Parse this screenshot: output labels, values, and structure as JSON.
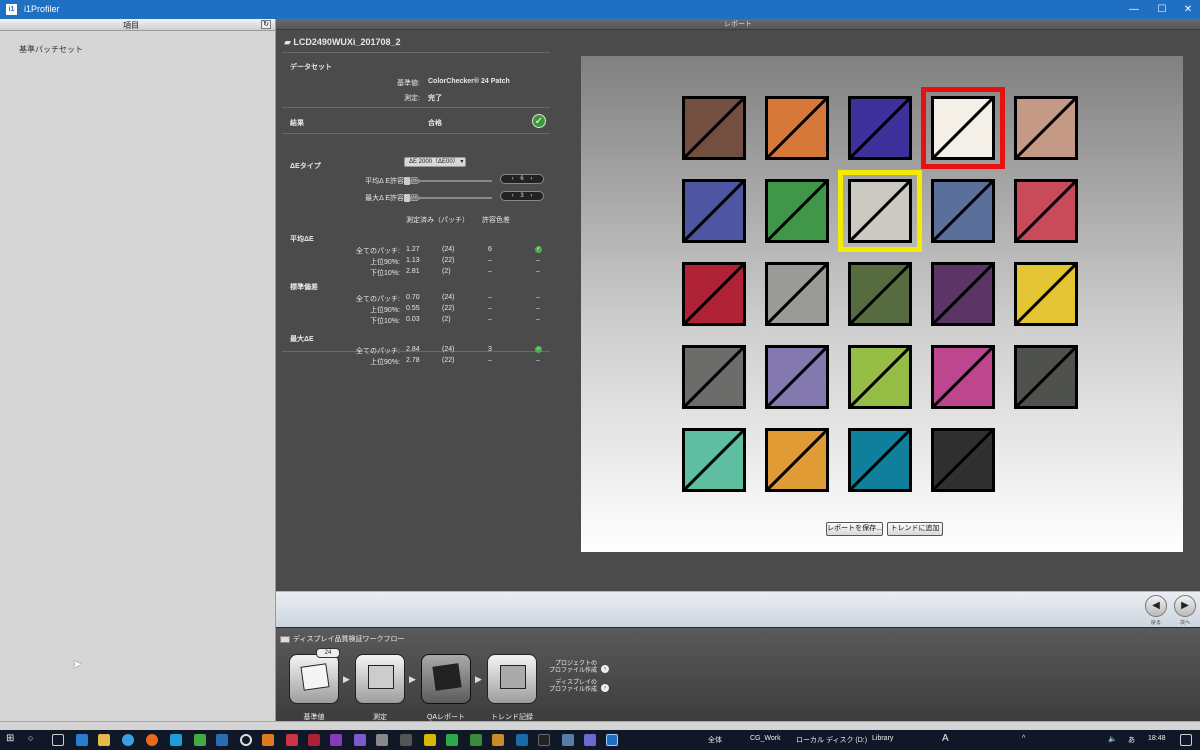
{
  "window": {
    "title": "i1Profiler",
    "app_icon": "i1",
    "min": "—",
    "max": "☐",
    "close": "✕"
  },
  "left_panel": {
    "header": "項目",
    "refresh_icon": "↻",
    "item": "基準パッチセット"
  },
  "report_header": "レポート",
  "info": {
    "file_name": "LCD2490WUXi_201708_2",
    "dataset_label": "データセット",
    "reference_label": "基準値:",
    "reference_value": "ColorChecker® 24 Patch",
    "measure_label": "測定:",
    "measure_value": "完了",
    "result_label": "結果",
    "result_value": "合格",
    "de_type_label": "ΔEタイプ",
    "de_type_value": "ΔE 2000（ΔE00）",
    "avg_tol_label": "平均Δ E許容範囲:",
    "avg_tol_value": "6",
    "max_tol_label": "最大Δ E許容範囲:",
    "max_tol_value": "3",
    "col_measured": "測定済み（パッチ）",
    "col_tolerance": "許容色差",
    "groups": [
      {
        "title": "平均ΔE",
        "rows": [
          {
            "label": "全てのパッチ:",
            "value": "1.27",
            "count": "(24)",
            "tol": "6",
            "ok": true
          },
          {
            "label": "上位90%:",
            "value": "1.13",
            "count": "(22)",
            "tol": "–",
            "ok": false
          },
          {
            "label": "下位10%:",
            "value": "2.81",
            "count": "(2)",
            "tol": "–",
            "ok": false
          }
        ]
      },
      {
        "title": "標準偏差",
        "rows": [
          {
            "label": "全てのパッチ:",
            "value": "0.70",
            "count": "(24)",
            "tol": "–",
            "ok": false
          },
          {
            "label": "上位90%:",
            "value": "0.55",
            "count": "(22)",
            "tol": "–",
            "ok": false
          },
          {
            "label": "下位10%:",
            "value": "0.03",
            "count": "(2)",
            "tol": "–",
            "ok": false
          }
        ]
      },
      {
        "title": "最大ΔE",
        "rows": [
          {
            "label": "全てのパッチ:",
            "value": "2.84",
            "count": "(24)",
            "tol": "3",
            "ok": true
          },
          {
            "label": "上位90%:",
            "value": "2.78",
            "count": "(22)",
            "tol": "–",
            "ok": false
          }
        ]
      }
    ]
  },
  "patches": [
    [
      "#734f42",
      "#d6783a",
      "#3e319b",
      "#f4f0e8",
      "#c49a86"
    ],
    [
      "#4e55a1",
      "#409749",
      "#ccc9c3",
      "#5b6f9b",
      "#c94b5b"
    ],
    [
      "#b02337",
      "#9a9b97",
      "#566c40",
      "#5a3566",
      "#e3c534"
    ],
    [
      "#6c6d6a",
      "#8479ae",
      "#95bc45",
      "#bc478f",
      "#4f514d"
    ],
    [
      "#5dbea0",
      "#e09b34",
      "#0f7f9c",
      "#303030",
      ""
    ]
  ],
  "highlights": {
    "red": "#e81010",
    "yellow": "#f4ec00"
  },
  "report_buttons": {
    "save": "レポートを保存...",
    "trend": "トレンドに追加"
  },
  "nav": {
    "back": "戻る",
    "next": "次へ",
    "back_icon": "◀",
    "next_icon": "▶"
  },
  "workflow": {
    "title": "ディスプレイ品質検証ワークフロー",
    "badge": "24",
    "steps": [
      "基準値",
      "測定",
      "QAレポート",
      "トレンド記録"
    ],
    "link1": "プロジェクトの\nプロファイル作成",
    "link2": "ディスプレイの\nプロファイル作成",
    "link_icon": "›"
  },
  "taskbar": {
    "items": [
      "全体",
      "CG_Work",
      "ローカル ディスク (D:)",
      "Library"
    ],
    "ime": "A",
    "clock": "18:48"
  }
}
